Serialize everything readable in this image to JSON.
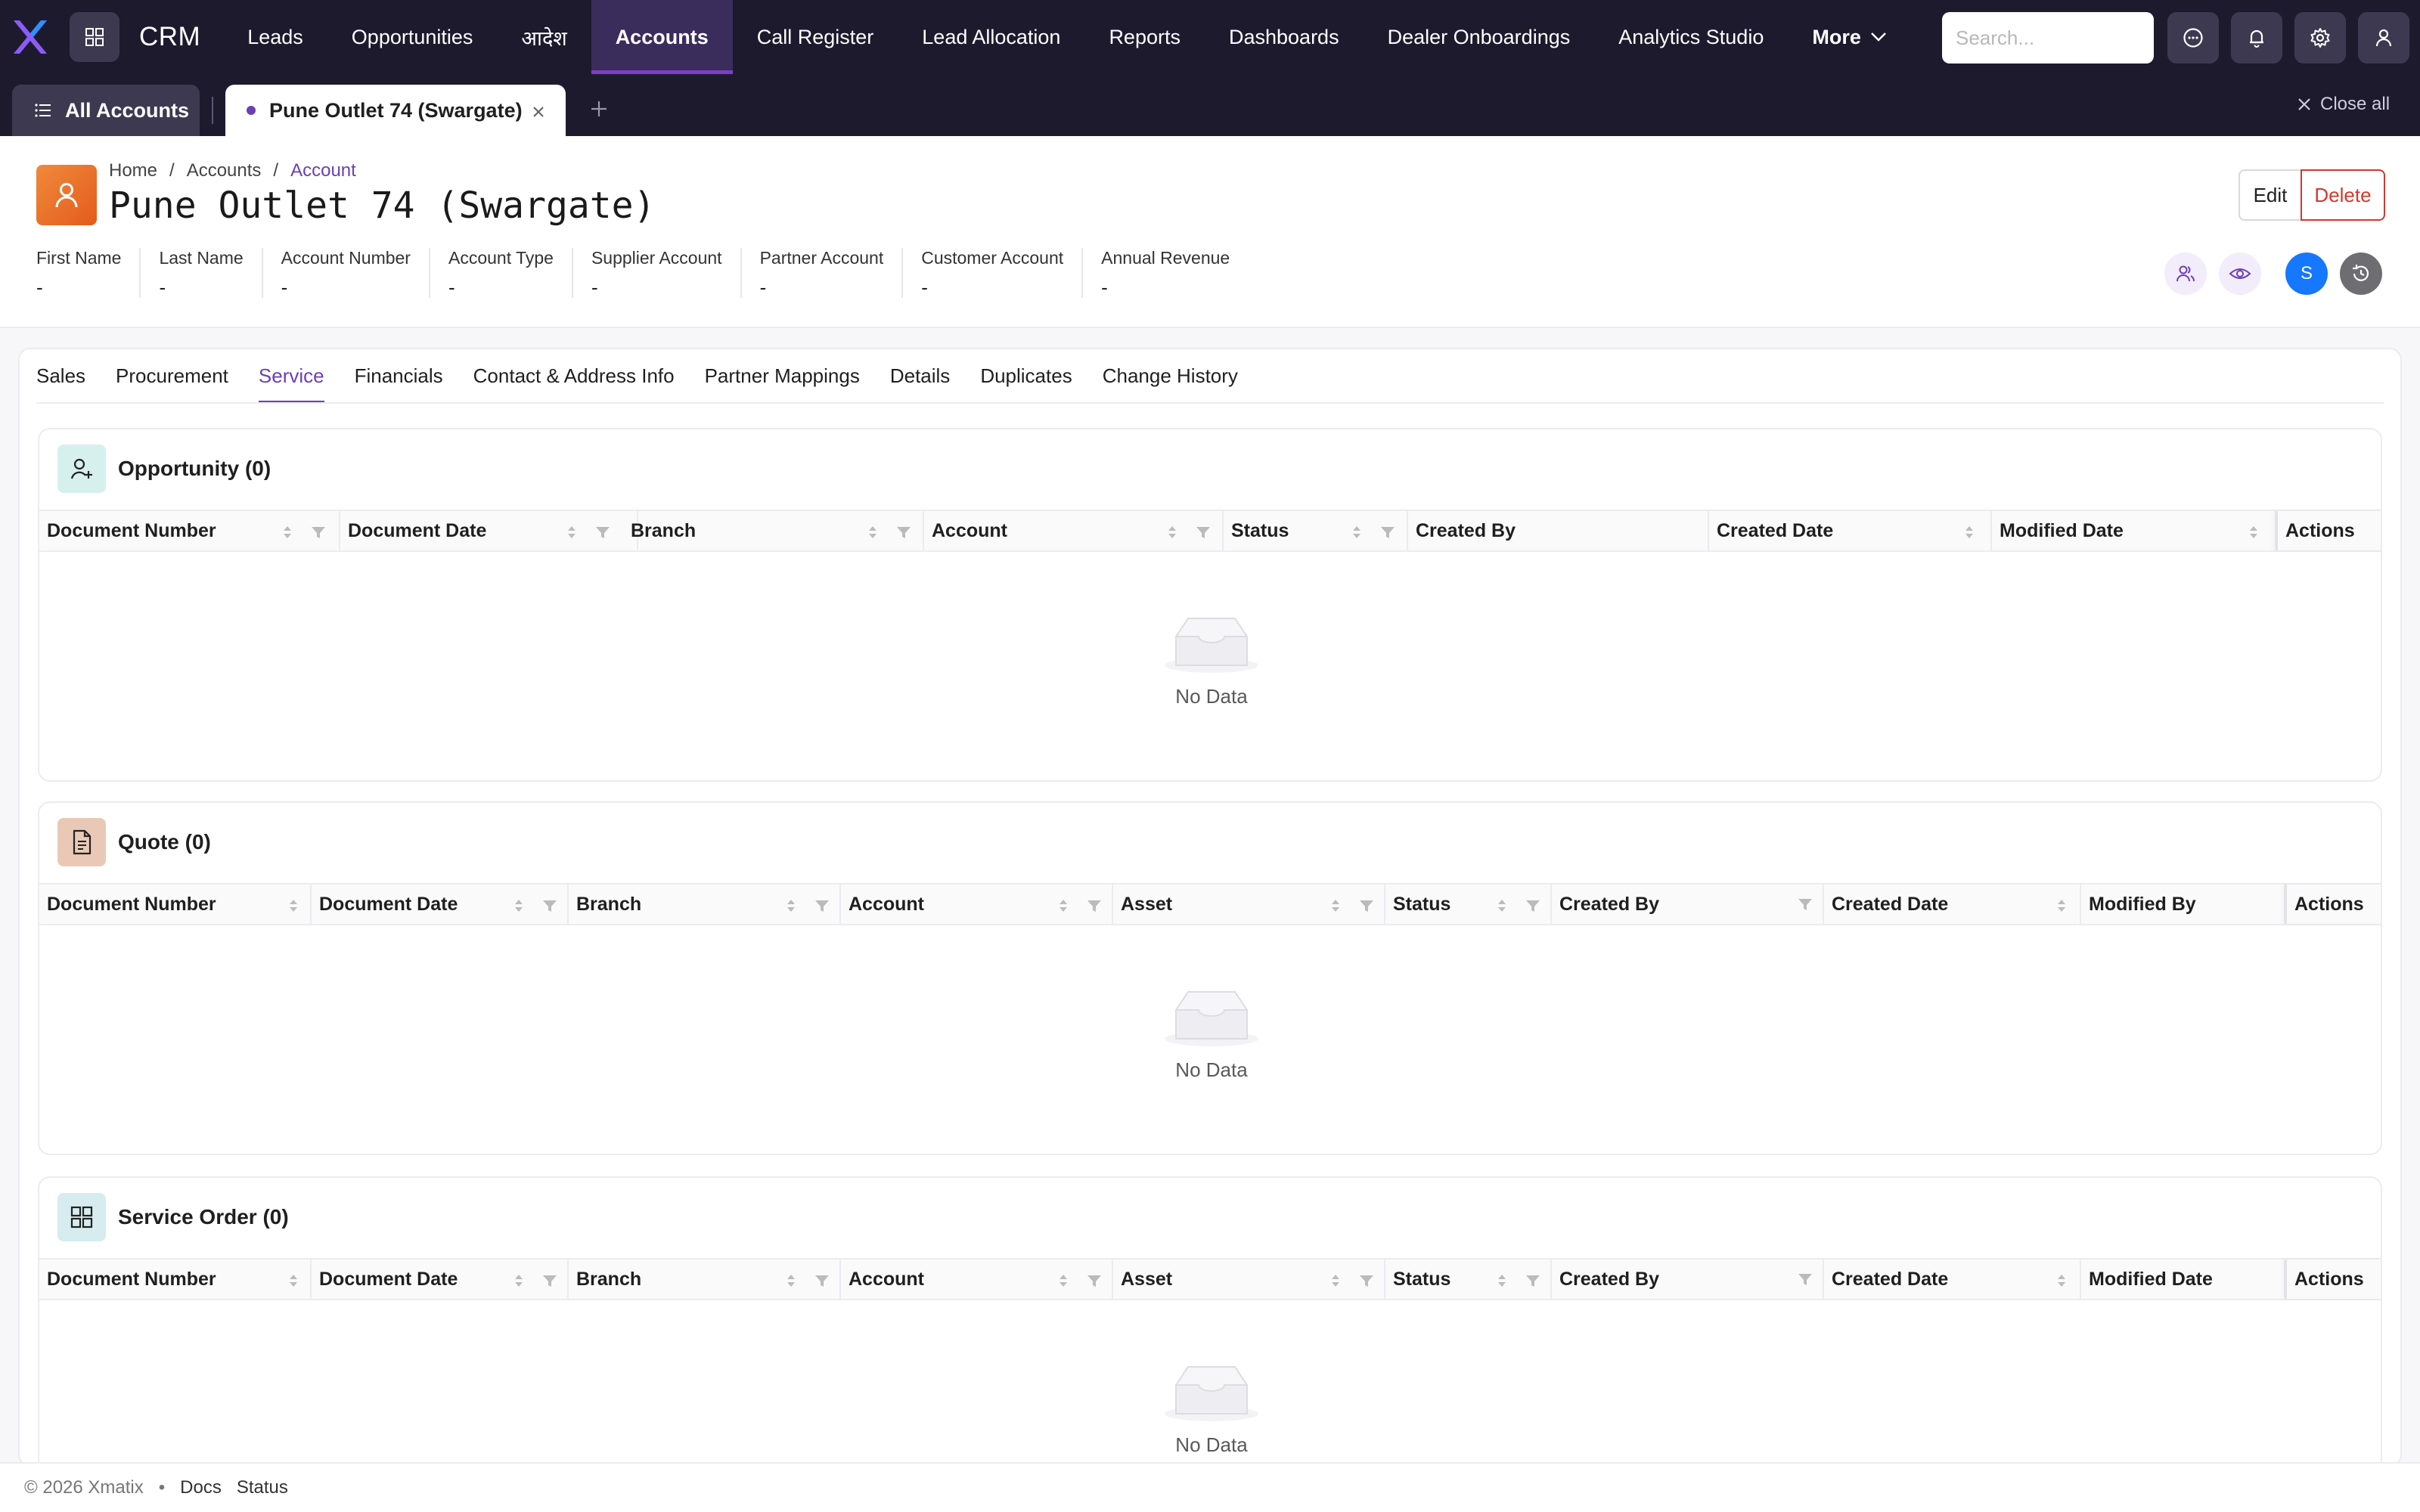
{
  "app": {
    "brand": "CRM"
  },
  "nav": {
    "items": [
      {
        "label": "Leads"
      },
      {
        "label": "Opportunities"
      },
      {
        "label": "आदेश"
      },
      {
        "label": "Accounts"
      },
      {
        "label": "Call Register"
      },
      {
        "label": "Lead Allocation"
      },
      {
        "label": "Reports"
      },
      {
        "label": "Dashboards"
      },
      {
        "label": "Dealer Onboardings"
      },
      {
        "label": "Analytics Studio"
      }
    ],
    "active_index": 3,
    "more_label": "More",
    "search_placeholder": "Search..."
  },
  "tabs": {
    "all_label": "All Accounts",
    "open_tab_label": "Pune Outlet 74 (Swargate)",
    "close_all_label": "Close all"
  },
  "header": {
    "breadcrumb": {
      "home": "Home",
      "section": "Accounts",
      "current": "Account"
    },
    "title": "Pune Outlet 74 (Swargate)",
    "edit_label": "Edit",
    "delete_label": "Delete",
    "avatar_initial": "S",
    "fields": [
      {
        "label": "First Name",
        "value": "-"
      },
      {
        "label": "Last Name",
        "value": "-"
      },
      {
        "label": "Account Number",
        "value": "-"
      },
      {
        "label": "Account Type",
        "value": "-"
      },
      {
        "label": "Supplier Account",
        "value": "-"
      },
      {
        "label": "Partner Account",
        "value": "-"
      },
      {
        "label": "Customer Account",
        "value": "-"
      },
      {
        "label": "Annual Revenue",
        "value": "-"
      }
    ]
  },
  "subtabs": {
    "items": [
      "Sales",
      "Procurement",
      "Service",
      "Financials",
      "Contact & Address Info",
      "Partner Mappings",
      "Details",
      "Duplicates",
      "Change History"
    ],
    "active": "Service"
  },
  "sections": [
    {
      "title": "Opportunity (0)",
      "icon": "user-plus-icon",
      "columns": [
        "Document Number",
        "Document Date",
        "Branch",
        "Account",
        "Status",
        "Created By",
        "Created Date",
        "Modified Date",
        "Actions"
      ],
      "empty_text": "No Data"
    },
    {
      "title": "Quote (0)",
      "icon": "document-icon",
      "columns": [
        "Document Number",
        "Document Date",
        "Branch",
        "Account",
        "Asset",
        "Status",
        "Created By",
        "Created Date",
        "Modified By",
        "Actions"
      ],
      "empty_text": "No Data"
    },
    {
      "title": "Service Order (0)",
      "icon": "grid-icon",
      "columns": [
        "Document Number",
        "Document Date",
        "Branch",
        "Account",
        "Asset",
        "Status",
        "Created By",
        "Created Date",
        "Modified Date",
        "Actions"
      ],
      "empty_text": "No Data"
    }
  ],
  "footer": {
    "copyright": "© 2026 Xmatix",
    "separator": "•",
    "docs": "Docs",
    "status": "Status"
  },
  "colors": {
    "nav_bg": "#1e1a2e",
    "accent": "#6c3fb5",
    "danger": "#d4382c",
    "avatar_blue": "#1677ff"
  }
}
